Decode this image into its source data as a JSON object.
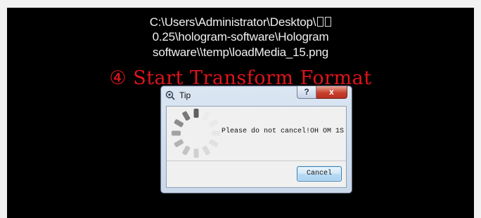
{
  "background": {
    "path_line_1": "C:\\Users\\Administrator\\Desktop\\",
    "path_line_2": "0.25\\hologram-software\\Hologram",
    "path_line_3": "software\\\\temp\\loadMedia_15.png",
    "step_title": "④ Start Transform Format"
  },
  "dialog": {
    "title": "Tip",
    "help_label": "?",
    "close_label": "x",
    "message": "Please do not cancel!OH OM 1S",
    "cancel_label": "Cancel",
    "icons": {
      "app": "dialog-app-icon",
      "spinner": "loading-spinner-icon"
    }
  },
  "colors": {
    "canvas": "#000000",
    "step_title": "#e0141c",
    "path_text": "#f0f0f0",
    "close_button": "#c7402c"
  }
}
